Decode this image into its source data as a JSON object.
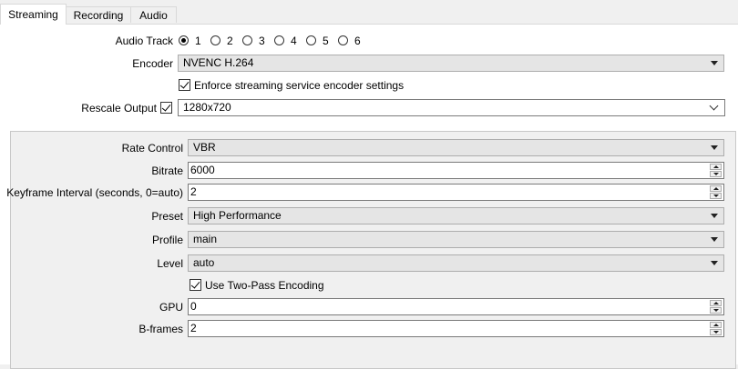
{
  "tabs": [
    {
      "label": "Streaming",
      "active": true
    },
    {
      "label": "Recording",
      "active": false
    },
    {
      "label": "Audio",
      "active": false
    }
  ],
  "audio_track": {
    "label": "Audio Track",
    "options": [
      "1",
      "2",
      "3",
      "4",
      "5",
      "6"
    ],
    "selected": "1"
  },
  "encoder": {
    "label": "Encoder",
    "value": "NVENC H.264"
  },
  "enforce": {
    "label": "Enforce streaming service encoder settings",
    "checked": true
  },
  "rescale": {
    "label": "Rescale Output",
    "checked": true,
    "value": "1280x720"
  },
  "settings": {
    "rate_control": {
      "label": "Rate Control",
      "value": "VBR"
    },
    "bitrate": {
      "label": "Bitrate",
      "value": "6000"
    },
    "keyframe": {
      "label": "Keyframe Interval (seconds, 0=auto)",
      "value": "2"
    },
    "preset": {
      "label": "Preset",
      "value": "High Performance"
    },
    "profile": {
      "label": "Profile",
      "value": "main"
    },
    "level": {
      "label": "Level",
      "value": "auto"
    },
    "two_pass": {
      "label": "Use Two-Pass Encoding",
      "checked": true
    },
    "gpu": {
      "label": "GPU",
      "value": "0"
    },
    "bframes": {
      "label": "B-frames",
      "value": "2"
    }
  }
}
